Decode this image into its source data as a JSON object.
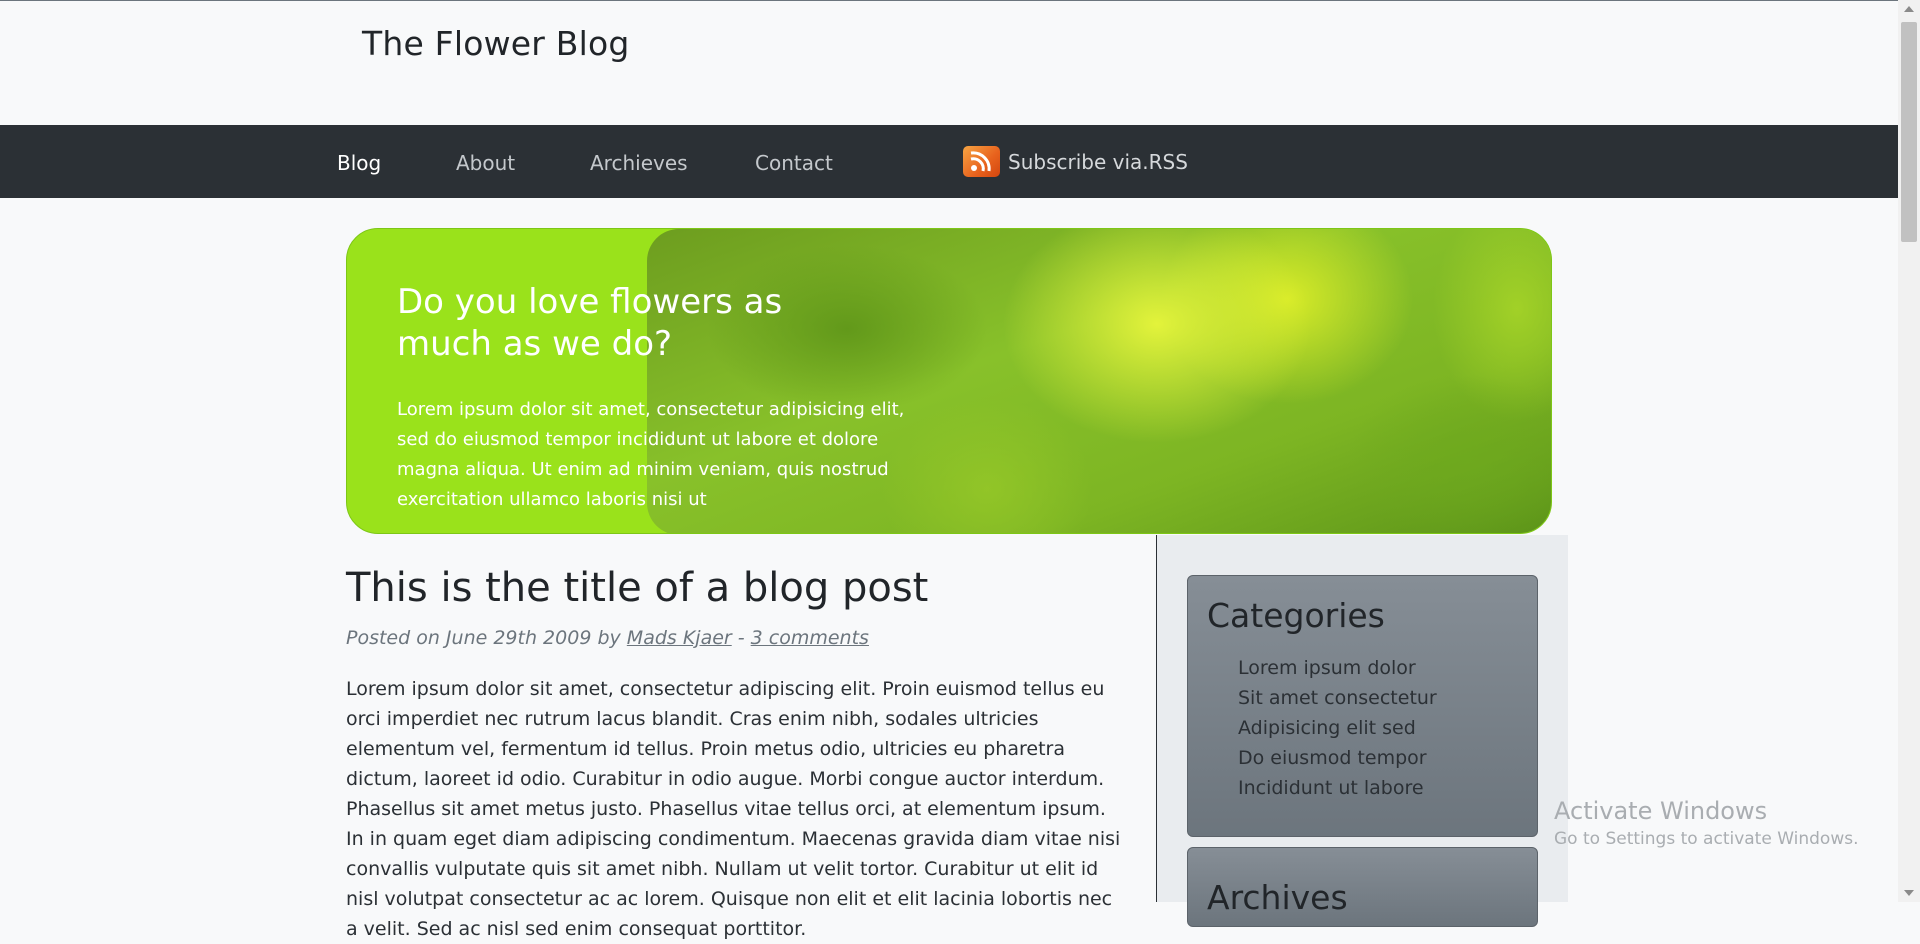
{
  "site": {
    "title": "The Flower Blog"
  },
  "nav": {
    "items": [
      {
        "label": "Blog",
        "active": true
      },
      {
        "label": "About",
        "active": false
      },
      {
        "label": "Archieves",
        "active": false
      },
      {
        "label": "Contact",
        "active": false
      }
    ],
    "rss_label": "Subscribe via.RSS",
    "rss_icon": "rss-icon"
  },
  "hero": {
    "title": "Do you love flowers as much as we do?",
    "text": "Lorem ipsum dolor sit amet, consectetur adipisicing elit, sed do eiusmod tempor incididunt ut labore et dolore magna aliqua. Ut enim ad minim veniam, quis nostrud exercitation ullamco laboris nisi ut"
  },
  "post": {
    "title": "This is the title of a blog post",
    "meta_prefix": "Posted on June 29th 2009 by ",
    "author": "Mads Kjaer",
    "separator": " - ",
    "comments": "3 comments",
    "body": "Lorem ipsum dolor sit amet, consectetur adipiscing elit. Proin euismod tellus eu orci imperdiet nec rutrum lacus blandit. Cras enim nibh, sodales ultricies elementum vel, fermentum id tellus. Proin metus odio, ultricies eu pharetra dictum, laoreet id odio. Curabitur in odio augue. Morbi congue auctor interdum. Phasellus sit amet metus justo. Phasellus vitae tellus orci, at elementum ipsum. In in quam eget diam adipiscing condimentum. Maecenas gravida diam vitae nisi convallis vulputate quis sit amet nibh. Nullam ut velit tortor. Curabitur ut elit id nisl volutpat consectetur ac ac lorem. Quisque non elit et elit lacinia lobortis nec a velit. Sed ac nisl sed enim consequat porttitor."
  },
  "sidebar": {
    "categories": {
      "title": "Categories",
      "items": [
        "Lorem ipsum dolor",
        "Sit amet consectetur",
        "Adipisicing elit sed",
        "Do eiusmod tempor",
        "Incididunt ut labore"
      ]
    },
    "archives": {
      "title": "Archives"
    }
  },
  "watermark": {
    "title": "Activate Windows",
    "subtitle": "Go to Settings to activate Windows."
  }
}
